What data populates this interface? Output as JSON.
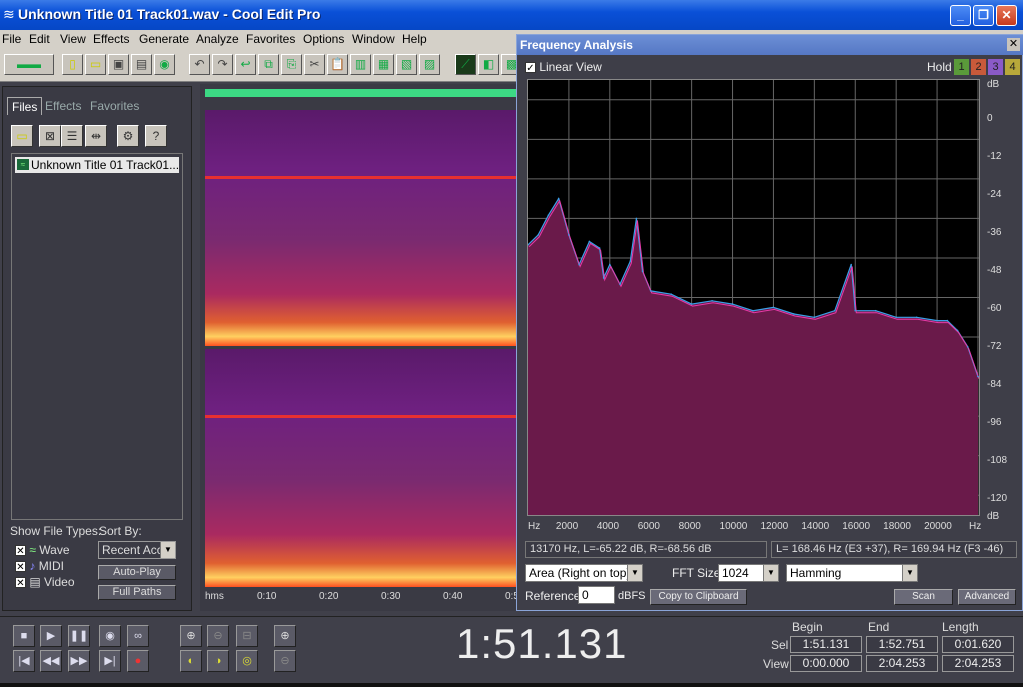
{
  "window": {
    "title": "Unknown Title 01 Track01.wav - Cool Edit Pro"
  },
  "menu": [
    "File",
    "Edit",
    "View",
    "Effects",
    "Generate",
    "Analyze",
    "Favorites",
    "Options",
    "Window",
    "Help"
  ],
  "panel": {
    "tabs": [
      "Files",
      "Effects",
      "Favorites"
    ],
    "file": "Unknown Title 01 Track01....",
    "show_types_label": "Show File Types:",
    "sort_label": "Sort By:",
    "types": [
      "Wave",
      "MIDI",
      "Video"
    ],
    "sort_value": "Recent Acc",
    "auto_play": "Auto-Play",
    "full_paths": "Full Paths"
  },
  "timeline": [
    "hms",
    "0:10",
    "0:20",
    "0:30",
    "0:40",
    "0:5"
  ],
  "fa": {
    "title": "Frequency Analysis",
    "linear_view": "Linear View",
    "hold": "Hold",
    "hold_buttons": [
      "1",
      "2",
      "3",
      "4"
    ],
    "y_ticks": [
      "dB",
      "0",
      "-12",
      "-24",
      "-36",
      "-48",
      "-60",
      "-72",
      "-84",
      "-96",
      "-108",
      "-120",
      "dB"
    ],
    "x_ticks": [
      "Hz",
      "2000",
      "4000",
      "6000",
      "8000",
      "10000",
      "12000",
      "14000",
      "16000",
      "18000",
      "20000",
      "Hz"
    ],
    "status_left": "13170 Hz, L=-65.22 dB, R=-68.56 dB",
    "status_right": "L= 168.46 Hz (E3 +37), R= 169.94 Hz (F3 -46)",
    "graph_mode": "Area (Right on top)",
    "fft_label": "FFT Size",
    "fft_size": "1024",
    "window_fn": "Hamming",
    "reference_label": "Reference",
    "reference_value": "0",
    "dbfs": "dBFS",
    "copy_btn": "Copy to Clipboard",
    "scan_btn": "Scan",
    "advanced_btn": "Advanced"
  },
  "transport": {
    "time": "1:51.131",
    "col_begin": "Begin",
    "col_end": "End",
    "col_length": "Length",
    "row_sel": "Sel",
    "row_view": "View",
    "sel": [
      "1:51.131",
      "1:52.751",
      "0:01.620"
    ],
    "view": [
      "0:00.000",
      "2:04.253",
      "2:04.253"
    ]
  },
  "chart_data": {
    "type": "area",
    "xlabel": "Hz",
    "ylabel": "dB",
    "xlim": [
      0,
      22050
    ],
    "ylim": [
      -126,
      6
    ],
    "x": [
      0,
      500,
      1000,
      1500,
      2000,
      2500,
      3000,
      3500,
      3700,
      4000,
      4500,
      5000,
      5300,
      5600,
      6000,
      7000,
      8000,
      9000,
      10000,
      11000,
      12000,
      13000,
      14000,
      15000,
      15800,
      16000,
      17000,
      18000,
      19000,
      20000,
      20500,
      21000,
      21500,
      22000
    ],
    "series": [
      {
        "values": [
          -44,
          -41,
          -35,
          -30,
          -41,
          -50,
          -43,
          -45,
          -54,
          -50,
          -56,
          -49,
          -36,
          -52,
          -58,
          -59,
          -62,
          -61,
          -62,
          -64,
          -63,
          -65,
          -66,
          -64,
          -50,
          -64,
          -64,
          -66,
          -66,
          -67,
          -67,
          -70,
          -75,
          -84
        ]
      }
    ]
  }
}
